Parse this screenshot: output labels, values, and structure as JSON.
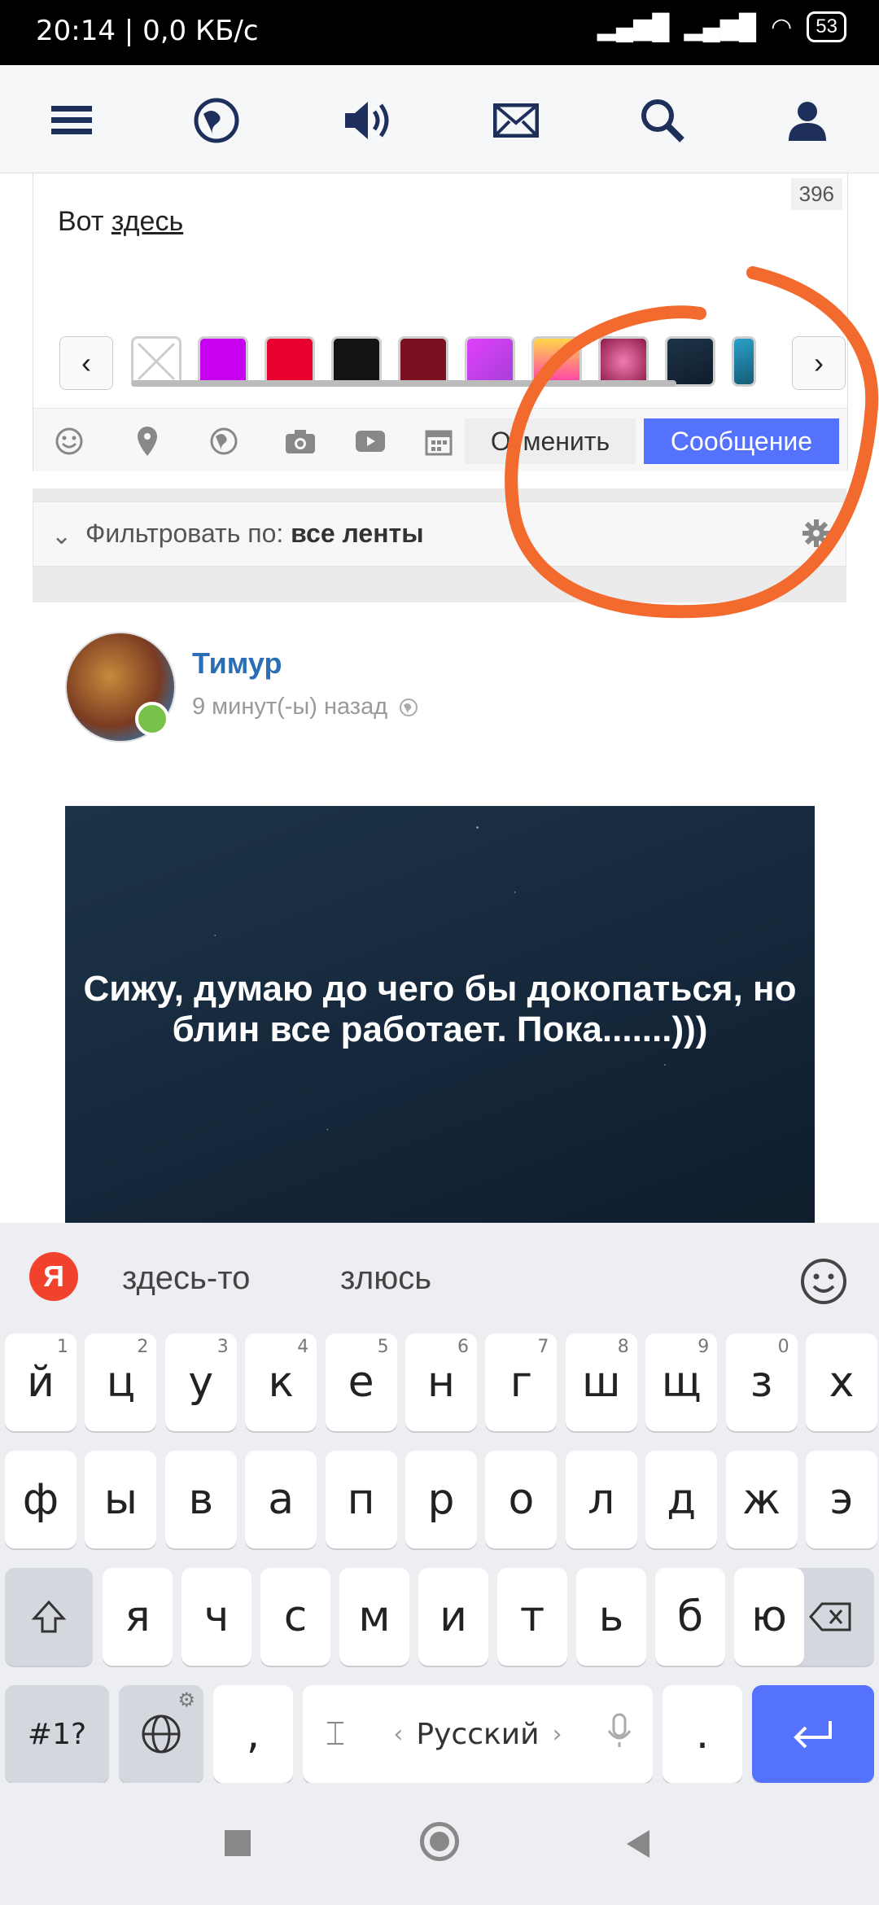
{
  "status_bar": {
    "time": "20:14",
    "net": "0,0 КБ/с",
    "battery": "53"
  },
  "composer": {
    "char_counter": "396",
    "text_before": "Вот ",
    "text_link": "здесь",
    "swatch_colors": [
      "#c800f0",
      "#e8002f",
      "#141414",
      "#7a1020",
      "#c23fe0",
      "#ff9a3c",
      "#c43a78",
      "#1a3040",
      "#2aa0c8"
    ],
    "cancel_label": "Отменить",
    "post_label": "Сообщение"
  },
  "filter": {
    "prefix": "Фильтровать по: ",
    "value": "все ленты"
  },
  "post": {
    "author": "Тимур",
    "time_ago": "9 минут(-ы) назад",
    "image_text": "Сижу, думаю до чего бы докопаться, но блин все работает. Пока.......)))"
  },
  "keyboard": {
    "suggestions": [
      "здесь-то",
      "злюсь"
    ],
    "row1": [
      {
        "k": "й",
        "h": "1"
      },
      {
        "k": "ц",
        "h": "2"
      },
      {
        "k": "у",
        "h": "3"
      },
      {
        "k": "к",
        "h": "4"
      },
      {
        "k": "е",
        "h": "5"
      },
      {
        "k": "н",
        "h": "6"
      },
      {
        "k": "г",
        "h": "7"
      },
      {
        "k": "ш",
        "h": "8"
      },
      {
        "k": "щ",
        "h": "9"
      },
      {
        "k": "з",
        "h": "0"
      },
      {
        "k": "х",
        "h": ""
      }
    ],
    "row2": [
      "ф",
      "ы",
      "в",
      "а",
      "п",
      "р",
      "о",
      "л",
      "д",
      "ж",
      "э"
    ],
    "row3": [
      "я",
      "ч",
      "с",
      "м",
      "и",
      "т",
      "ь",
      "б",
      "ю"
    ],
    "symbols_label": "#1?",
    "comma": ",",
    "language_label": "Русский",
    "period": "."
  },
  "colors": {
    "accent": "#5572ff",
    "link": "#2a6fb5",
    "annotation": "#f26a2e",
    "online": "#78c24a"
  }
}
